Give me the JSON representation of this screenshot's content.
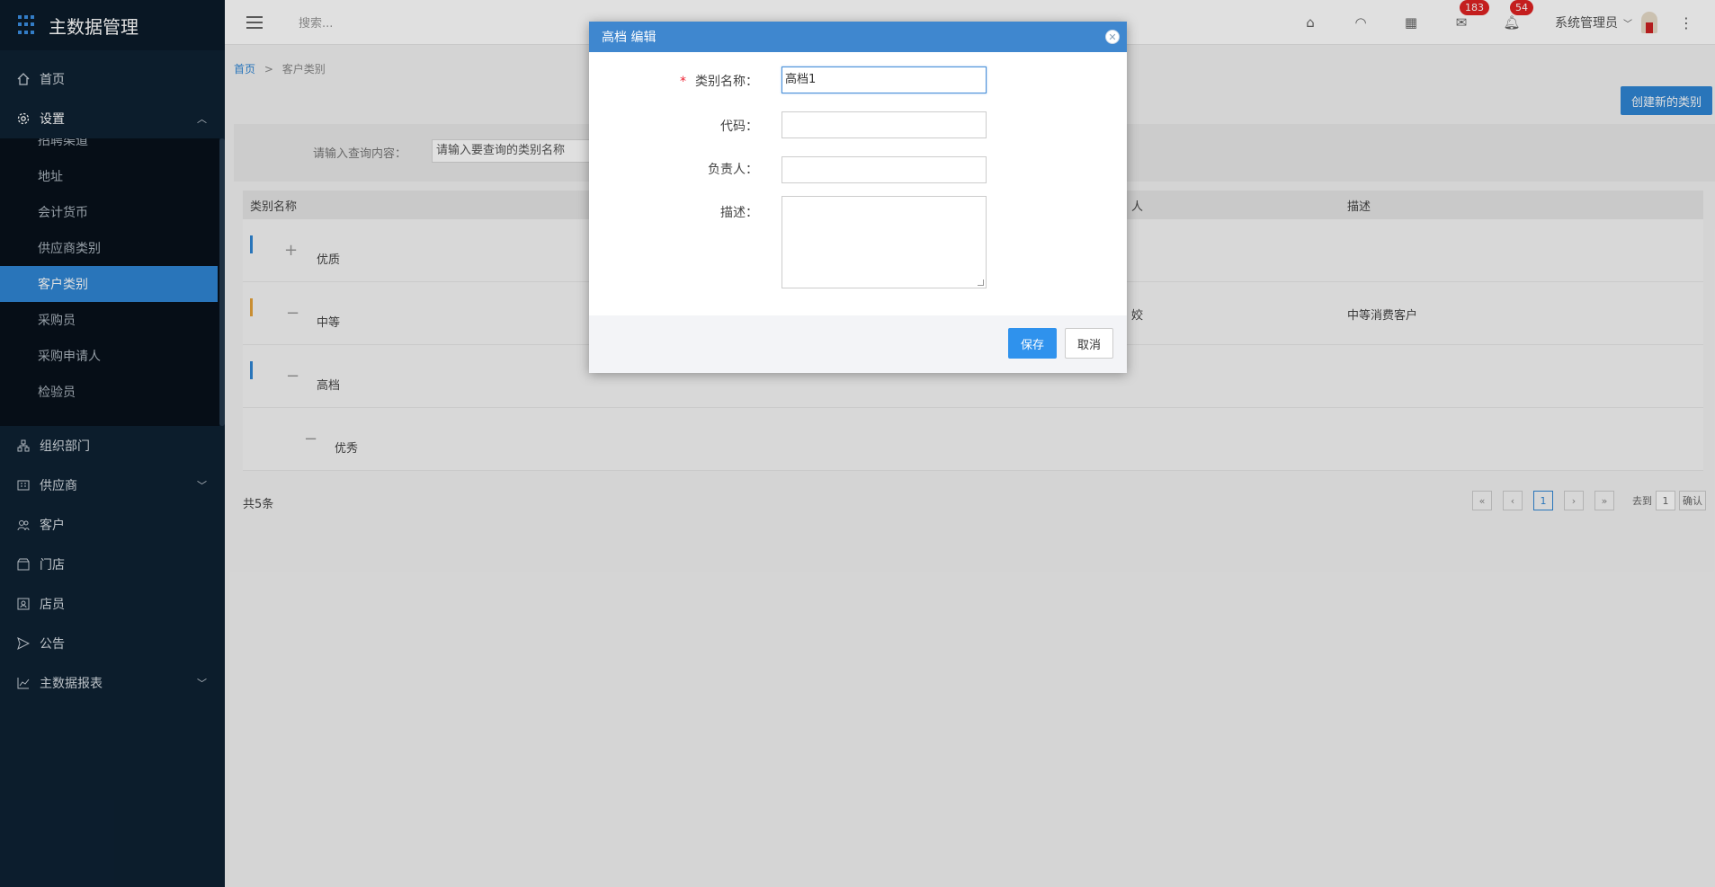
{
  "app": {
    "title": "主数据管理"
  },
  "sidebar": {
    "home": "首页",
    "settings": "设置",
    "sub_items": [
      "招聘渠道",
      "地址",
      "会计货币",
      "供应商类别",
      "客户类别",
      "采购员",
      "采购申请人",
      "检验员"
    ],
    "active_sub": "客户类别",
    "org": "组织部门",
    "supplier": "供应商",
    "customer": "客户",
    "store": "门店",
    "clerk": "店员",
    "notice": "公告",
    "report": "主数据报表"
  },
  "topbar": {
    "search_placeholder": "搜索...",
    "badge_mail": "183",
    "badge_bell": "54",
    "user": "系统管理员"
  },
  "breadcrumb": {
    "home": "首页",
    "sep": ">",
    "current": "客户类别"
  },
  "toolbar": {
    "create_label": "创建新的类别"
  },
  "search": {
    "label": "请输入查询内容：",
    "placeholder": "请输入要查询的类别名称"
  },
  "table": {
    "headers": {
      "name": "类别名称",
      "owner": "人",
      "desc": "描述"
    },
    "rows": [
      {
        "sign": "+",
        "name": "优质",
        "owner": "",
        "desc": "",
        "bar_color": "#2f86d4"
      },
      {
        "sign": "−",
        "name": "中等",
        "owner": "姣",
        "desc": "中等消费客户",
        "bar_color": "#e5a23b"
      },
      {
        "sign": "−",
        "name": "高档",
        "owner": "",
        "desc": "",
        "bar_color": "#2f86d4"
      },
      {
        "sign": "−",
        "name": "优秀",
        "owner": "",
        "desc": "",
        "bar_color": ""
      }
    ],
    "total": "共5条"
  },
  "pager": {
    "first": "«",
    "prev": "‹",
    "page": "1",
    "next": "›",
    "last": "»",
    "goto_label": "去到",
    "goto_value": "1",
    "confirm": "确认"
  },
  "modal": {
    "title": "高档 编辑",
    "name_label": "类别名称：",
    "name_value": "高档1",
    "code_label": "代码：",
    "owner_label": "负责人：",
    "desc_label": "描述：",
    "save": "保存",
    "cancel": "取消",
    "required_mark": "*"
  }
}
